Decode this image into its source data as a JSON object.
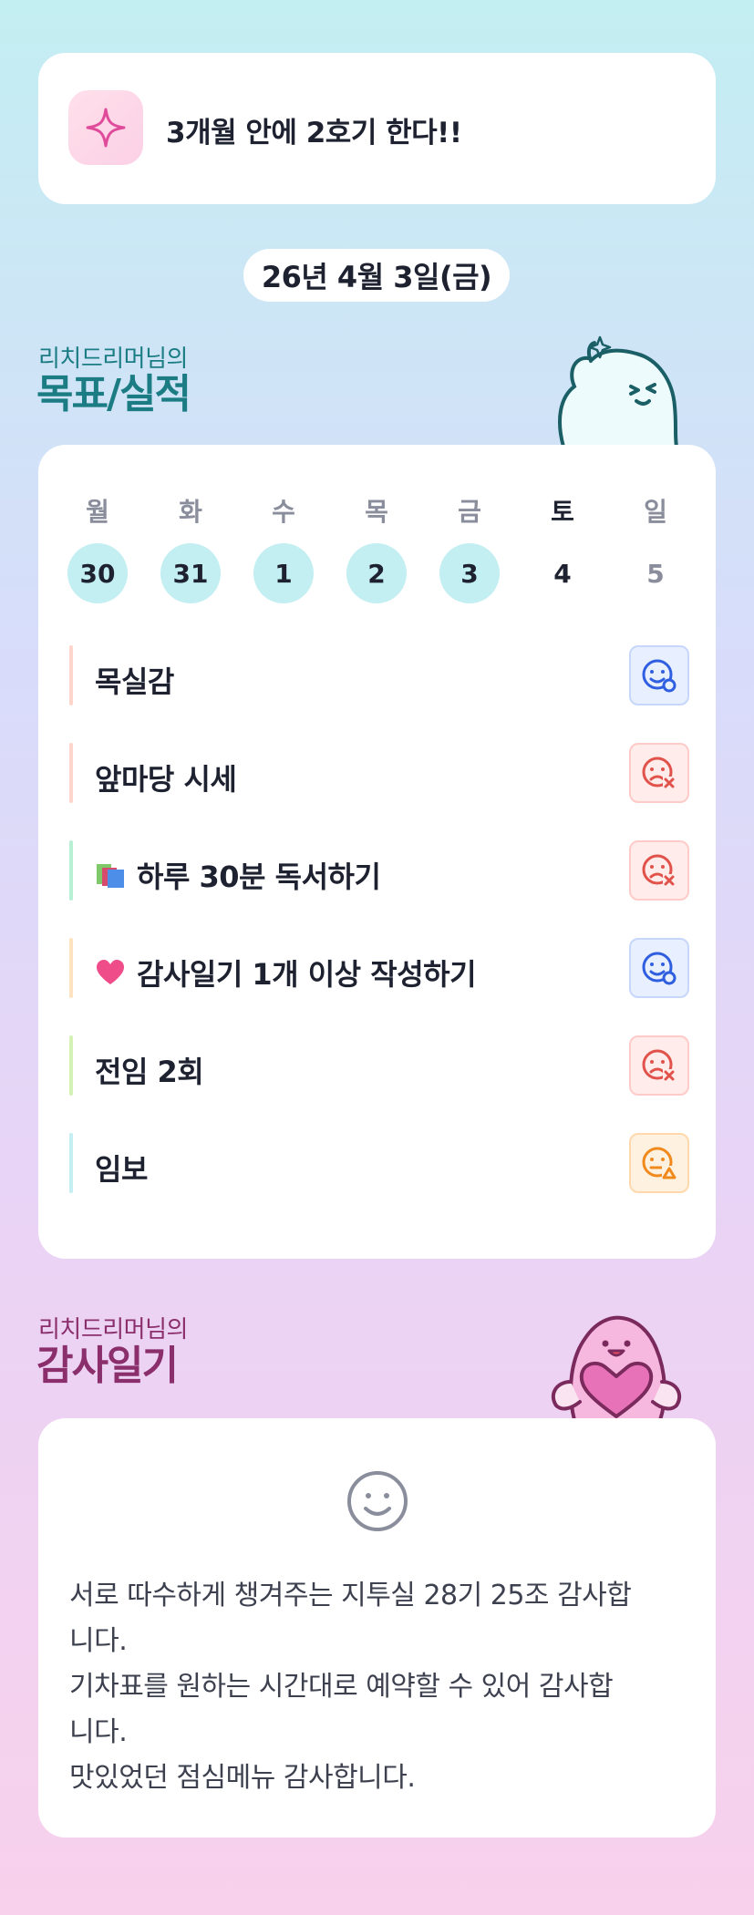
{
  "goal_banner": {
    "text": "3개월 안에 2호기 한다!!",
    "icon": "sparkle-icon"
  },
  "date": "26년 4월 3일(금)",
  "goals_section": {
    "user": "리치드리머님의",
    "title": "목표/실적"
  },
  "week": {
    "days": [
      {
        "weekday": "월",
        "date": "30",
        "state": "done"
      },
      {
        "weekday": "화",
        "date": "31",
        "state": "done"
      },
      {
        "weekday": "수",
        "date": "1",
        "state": "done"
      },
      {
        "weekday": "목",
        "date": "2",
        "state": "done"
      },
      {
        "weekday": "금",
        "date": "3",
        "state": "done"
      },
      {
        "weekday": "토",
        "date": "4",
        "state": "plain"
      },
      {
        "weekday": "일",
        "date": "5",
        "state": "muted"
      }
    ]
  },
  "tasks": [
    {
      "label": "목실감",
      "emoji": "",
      "bar_color": "#ffd5cc",
      "status": "good"
    },
    {
      "label": "앞마당 시세",
      "emoji": "",
      "bar_color": "#ffd5cc",
      "status": "bad"
    },
    {
      "label": "하루 30분 독서하기",
      "emoji": "📚",
      "bar_color": "#b8f0d4",
      "status": "bad"
    },
    {
      "label": "감사일기 1개 이상 작성하기",
      "emoji": "💗",
      "bar_color": "#ffe2bf",
      "status": "good"
    },
    {
      "label": "전임 2회",
      "emoji": "",
      "bar_color": "#d4f2b5",
      "status": "bad"
    },
    {
      "label": "임보",
      "emoji": "",
      "bar_color": "#c3eef2",
      "status": "mid"
    }
  ],
  "gratitude_section": {
    "user": "리치드리머님의",
    "title": "감사일기"
  },
  "gratitude": {
    "icon": "smile-icon",
    "lines": [
      "서로 따수하게 챙겨주는 지투실 28기 25조 감사합",
      "니다.",
      "기차표를 원하는 시간대로 예약할 수 있어 감사합",
      "니다.",
      "맛있었던 점심메뉴 감사합니다."
    ]
  },
  "colors": {
    "goals_title": "#1b7d83",
    "gratitude_title": "#8b2f6c",
    "good": "#2f5ee0",
    "bad": "#e0524a",
    "mid": "#f08a1c"
  }
}
